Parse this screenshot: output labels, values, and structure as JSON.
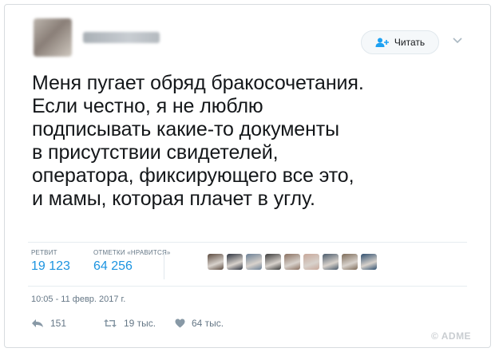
{
  "tweet": {
    "follow_label": "Читать",
    "text_lines": [
      "Меня пугает обряд бракосочетания.",
      "Если честно, я не люблю",
      "подписывать какие-то документы",
      "в присутствии свидетелей,",
      "оператора, фиксирующего все это,",
      "и мамы, которая плачет в углу."
    ],
    "stats": {
      "retweets_label": "РЕТВИТ",
      "retweets_value": "19 123",
      "likes_label": "ОТМЕТКИ «НРАВИТСЯ»",
      "likes_value": "64 256"
    },
    "date": "10:05 - 11 февр. 2017 г.",
    "actions": {
      "reply_count": "151",
      "retweet_count": "19 тыс.",
      "like_count": "64 тыс."
    }
  },
  "liker_colors": [
    "#5b4a3f",
    "#2e3440",
    "#6a7f95",
    "#3b3b3b",
    "#8a7060",
    "#c7a89a",
    "#4a5a6b",
    "#7d6b58",
    "#2f4f6f"
  ],
  "watermark": "© ADME",
  "colors": {
    "accent": "#1c94e0",
    "secondary_text": "#657786"
  },
  "icons": {
    "follow": "add-user-icon",
    "caret": "chevron-down-icon",
    "reply": "reply-icon",
    "retweet": "retweet-icon",
    "like": "heart-icon"
  }
}
